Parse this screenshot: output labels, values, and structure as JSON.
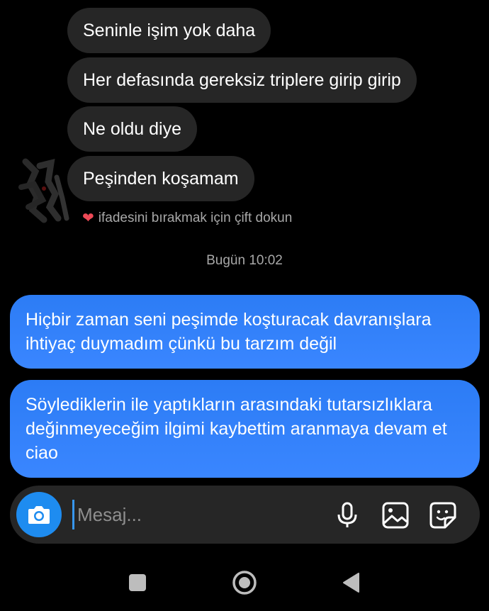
{
  "thread": {
    "incoming": [
      {
        "text": "Seninle işim yok daha"
      },
      {
        "text": "Her defasında gereksiz triplere girip girip"
      },
      {
        "text": "Ne oldu diye"
      },
      {
        "text": "Peşinden koşamam"
      }
    ],
    "reaction_hint": "ifadesini bırakmak için çift dokun",
    "reaction_icon": "heart-icon",
    "timestamp": "Bugün 10:02",
    "outgoing": [
      {
        "text": "Hiçbir zaman seni peşimde koşturacak davranışlara ihtiyaç duymadım çünkü bu tarzım değil"
      },
      {
        "text": "Söylediklerin ile yaptıkların arasındaki tutarsızlıklara değinmeyeceğim ilgimi kaybettim aranmaya devam et ciao"
      }
    ]
  },
  "composer": {
    "placeholder": "Mesaj...",
    "value": "",
    "icons": [
      "camera-icon",
      "microphone-icon",
      "gallery-icon",
      "sticker-icon"
    ]
  },
  "navbar": {
    "icons": [
      "recents-icon",
      "home-icon",
      "back-icon"
    ]
  },
  "colors": {
    "background": "#000000",
    "incoming_bubble": "#262626",
    "outgoing_bubble": "#3797f0",
    "camera_button": "#1e8cf0",
    "muted_text": "#a8a8a8",
    "heart": "#ed4956"
  }
}
